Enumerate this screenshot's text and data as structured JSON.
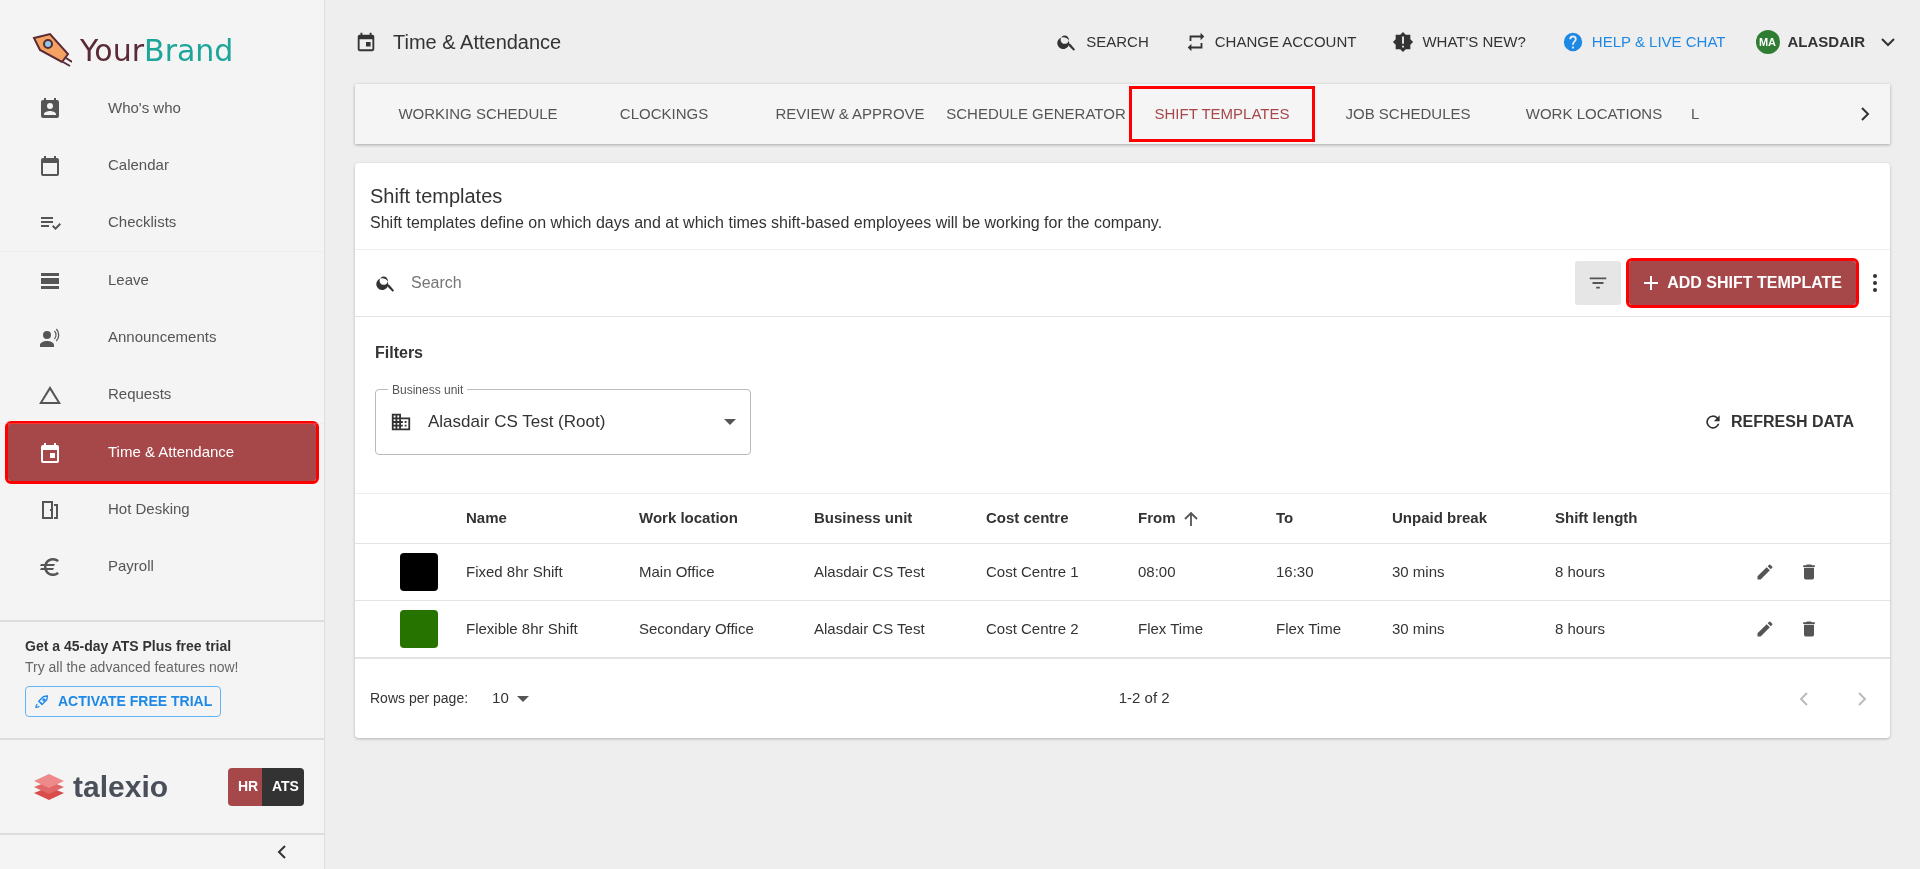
{
  "brand": {
    "part_1": "Your",
    "part_2": "Brand"
  },
  "sidebar": {
    "items": [
      {
        "label": "Who's who",
        "selected": false
      },
      {
        "label": "Calendar",
        "selected": false
      },
      {
        "label": "Checklists",
        "selected": false
      },
      {
        "label": "Leave",
        "selected": false
      },
      {
        "label": "Announcements",
        "selected": false
      },
      {
        "label": "Requests",
        "selected": false
      },
      {
        "label": "Time & Attendance",
        "selected": true
      },
      {
        "label": "Hot Desking",
        "selected": false
      },
      {
        "label": "Payroll",
        "selected": false
      }
    ],
    "trial": {
      "title": "Get a 45-day ATS Plus free trial",
      "subtitle": "Try all the advanced features now!",
      "button": "ACTIVATE FREE TRIAL"
    },
    "product_logo": "talexio",
    "modules": [
      {
        "label": "HR",
        "selected": true
      },
      {
        "label": "ATS",
        "selected": false
      }
    ]
  },
  "header": {
    "title": "Time & Attendance",
    "actions": [
      {
        "label": "SEARCH",
        "kind": "plain"
      },
      {
        "label": "CHANGE ACCOUNT",
        "kind": "plain"
      },
      {
        "label": "WHAT'S NEW?",
        "kind": "plain"
      },
      {
        "label": "HELP & LIVE CHAT",
        "kind": "link"
      }
    ],
    "user": {
      "initials": "MA",
      "name": "ALASDAIR"
    }
  },
  "tabs": [
    {
      "label": "WORKING SCHEDULE",
      "selected": false
    },
    {
      "label": "CLOCKINGS",
      "selected": false
    },
    {
      "label": "REVIEW & APPROVE",
      "selected": false
    },
    {
      "label": "SCHEDULE GENERATOR",
      "selected": false
    },
    {
      "label": "SHIFT TEMPLATES",
      "selected": true
    },
    {
      "label": "JOB SCHEDULES",
      "selected": false
    },
    {
      "label": "WORK LOCATIONS",
      "selected": false
    },
    {
      "label": "L",
      "selected": false
    }
  ],
  "panel": {
    "title": "Shift templates",
    "description": "Shift templates define on which days and at which times shift-based employees will be working for the company.",
    "search": {
      "placeholder": "Search"
    },
    "add_button": "ADD SHIFT TEMPLATE",
    "filters": {
      "title": "Filters",
      "business_unit": {
        "label": "Business unit",
        "value": "Alasdair CS Test (Root)"
      },
      "refresh": "REFRESH DATA"
    },
    "table": {
      "columns": [
        {
          "label": "Name",
          "sorted": false
        },
        {
          "label": "Work location",
          "sorted": false
        },
        {
          "label": "Business unit",
          "sorted": false
        },
        {
          "label": "Cost centre",
          "sorted": false
        },
        {
          "label": "From",
          "sorted": true
        },
        {
          "label": "To",
          "sorted": false
        },
        {
          "label": "Unpaid break",
          "sorted": false
        },
        {
          "label": "Shift length",
          "sorted": false
        }
      ],
      "rows": [
        {
          "color": "#000000",
          "cells": [
            "Fixed 8hr Shift",
            "Main Office",
            "Alasdair CS Test",
            "Cost Centre 1",
            "08:00",
            "16:30",
            "30 mins",
            "8 hours"
          ]
        },
        {
          "color": "#267300",
          "cells": [
            "Flexible 8hr Shift",
            "Secondary Office",
            "Alasdair CS Test",
            "Cost Centre 2",
            "Flex Time",
            "Flex Time",
            "30 mins",
            "8 hours"
          ]
        }
      ]
    },
    "footer": {
      "rows_label": "Rows per page:",
      "rows_value": "10",
      "range": "1-2 of 2"
    }
  }
}
